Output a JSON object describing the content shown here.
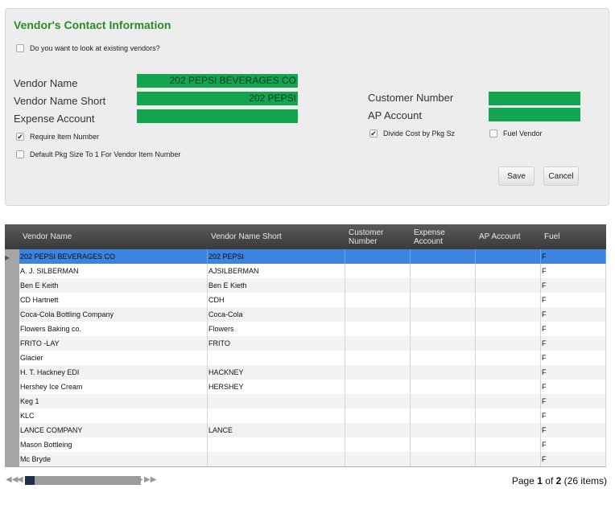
{
  "form": {
    "title": "Vendor's Contact Information",
    "existing_vendors_label": "Do you want to look at existing vendors?",
    "vendor_name_label": "Vendor Name",
    "vendor_name_value": "202 PEPSI BEVERAGES CO",
    "vendor_name_short_label": "Vendor Name Short",
    "vendor_name_short_value": "202 PEPSI",
    "expense_account_label": "Expense Account",
    "expense_account_value": "",
    "customer_number_label": "Customer Number",
    "customer_number_value": "",
    "ap_account_label": "AP Account",
    "ap_account_value": "",
    "require_item_number_label": "Require Item Number",
    "require_item_number_checked": true,
    "default_pkg_label": "Default Pkg Size To 1 For Vendor Item Number",
    "default_pkg_checked": false,
    "divide_cost_label": "Divide Cost by Pkg Sz",
    "divide_cost_checked": true,
    "fuel_vendor_label": "Fuel Vendor",
    "fuel_vendor_checked": false,
    "save_label": "Save",
    "cancel_label": "Cancel",
    "field_color": "#13a550",
    "title_color": "#2a8a2a"
  },
  "grid": {
    "columns": [
      {
        "label": "Vendor Name"
      },
      {
        "label": "Vendor Name Short"
      },
      {
        "label": "Customer Number"
      },
      {
        "label": "Expense Account"
      },
      {
        "label": "AP Account"
      },
      {
        "label": "Fuel"
      }
    ],
    "rows": [
      {
        "name": "202 PEPSI BEVERAGES CO",
        "short": "202 PEPSI",
        "customer": "",
        "expense": "",
        "ap": "",
        "fuel": "F",
        "selected": true
      },
      {
        "name": "A. J. SILBERMAN",
        "short": "AJSILBERMAN",
        "customer": "",
        "expense": "",
        "ap": "",
        "fuel": "F"
      },
      {
        "name": "Ben E Keith",
        "short": "Ben E Kieth",
        "customer": "",
        "expense": "",
        "ap": "",
        "fuel": "F"
      },
      {
        "name": "CD Hartnett",
        "short": "CDH",
        "customer": "",
        "expense": "",
        "ap": "",
        "fuel": "F"
      },
      {
        "name": "Coca-Cola Bottling Company",
        "short": "Coca-Cola",
        "customer": "",
        "expense": "",
        "ap": "",
        "fuel": "F"
      },
      {
        "name": "Flowers Baking co.",
        "short": "Flowers",
        "customer": "",
        "expense": "",
        "ap": "",
        "fuel": "F"
      },
      {
        "name": "FRITO -LAY",
        "short": "FRITO",
        "customer": "",
        "expense": "",
        "ap": "",
        "fuel": "F"
      },
      {
        "name": "Glacier",
        "short": "",
        "customer": "",
        "expense": "",
        "ap": "",
        "fuel": "F"
      },
      {
        "name": "H. T. Hackney EDI",
        "short": "HACKNEY",
        "customer": "",
        "expense": "",
        "ap": "",
        "fuel": "F"
      },
      {
        "name": "Hershey Ice Cream",
        "short": "HERSHEY",
        "customer": "",
        "expense": "",
        "ap": "",
        "fuel": "F"
      },
      {
        "name": "Keg 1",
        "short": "",
        "customer": "",
        "expense": "",
        "ap": "",
        "fuel": "F"
      },
      {
        "name": "KLC",
        "short": "",
        "customer": "",
        "expense": "",
        "ap": "",
        "fuel": "F"
      },
      {
        "name": "LANCE COMPANY",
        "short": "LANCE",
        "customer": "",
        "expense": "",
        "ap": "",
        "fuel": "F"
      },
      {
        "name": "Mason Bottleing",
        "short": "",
        "customer": "",
        "expense": "",
        "ap": "",
        "fuel": "F"
      },
      {
        "name": "Mc Bryde",
        "short": "",
        "customer": "",
        "expense": "",
        "ap": "",
        "fuel": "F"
      }
    ],
    "selected_row_color": "#3d84e0",
    "header_color": "#4a4a4a"
  },
  "pager": {
    "page_prefix": "Page",
    "current_page": "1",
    "of_label": "of",
    "total_pages": "2",
    "items_label": "(26 items)",
    "icons": [
      "first-page-icon",
      "prev-page-icon",
      "next-page-icon",
      "last-page-icon"
    ]
  }
}
